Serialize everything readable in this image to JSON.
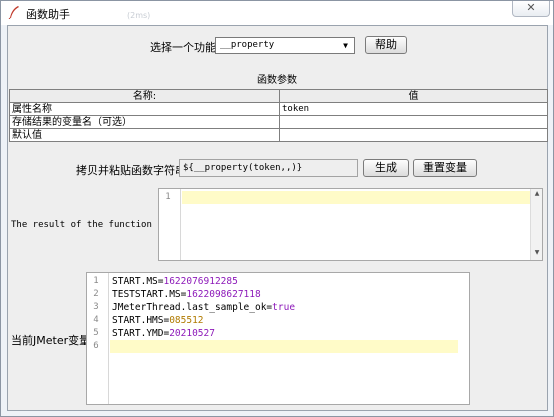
{
  "window": {
    "title": "函数助手",
    "close_label": "✕",
    "faint_text": "(2ms)"
  },
  "function_row": {
    "label": "选择一个功能",
    "selected_function": "__property",
    "help_button": "帮助"
  },
  "params": {
    "section_title": "函数参数",
    "columns": [
      "名称:",
      "值"
    ],
    "rows": [
      {
        "name": "属性名称",
        "value": "token"
      },
      {
        "name": "存储结果的变量名（可选）",
        "value": ""
      },
      {
        "name": "默认值",
        "value": ""
      }
    ]
  },
  "copy_row": {
    "label": "拷贝并粘贴函数字符串",
    "function_string": "${__property(token,,)}",
    "generate_button": "生成",
    "reset_button": "重置变量"
  },
  "result": {
    "label": "The result of the function is",
    "line_numbers": [
      "1"
    ]
  },
  "jmeter_vars": {
    "label": "当前JMeter变量",
    "lines": [
      {
        "num": "1",
        "key": "START.MS=",
        "val": "1622076912285",
        "kind": "n"
      },
      {
        "num": "2",
        "key": "TESTSTART.MS=",
        "val": "1622098627118",
        "kind": "n"
      },
      {
        "num": "3",
        "key": "JMeterThread.last_sample_ok=",
        "val": "true",
        "kind": "t"
      },
      {
        "num": "4",
        "key": "START.HMS=",
        "val": "085512",
        "kind": "o"
      },
      {
        "num": "5",
        "key": "START.YMD=",
        "val": "20210527",
        "kind": "n"
      },
      {
        "num": "6",
        "key": "",
        "val": "",
        "kind": "n"
      }
    ]
  },
  "colors": {
    "number": "#8d1ab9",
    "boolean": "#8d1ab9",
    "octal": "#b07a00",
    "current_line": "#fffbc8"
  }
}
